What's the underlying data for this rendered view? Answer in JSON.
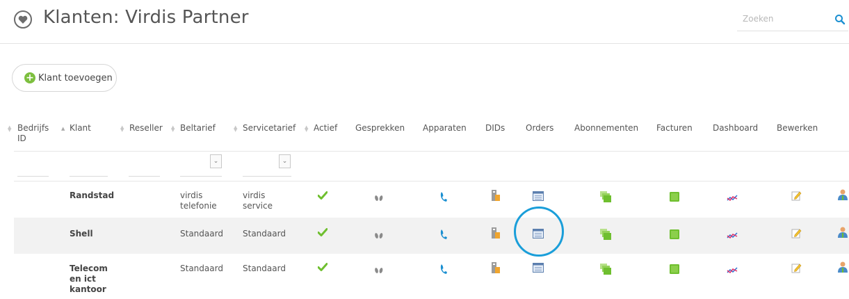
{
  "header": {
    "title": "Klanten: Virdis Partner",
    "search_placeholder": "Zoeken"
  },
  "toolbar": {
    "add_label": "Klant toevoegen"
  },
  "table": {
    "columns": [
      {
        "label": "Bedrijfs ID",
        "line1": "Bedrijfs",
        "line2": "ID"
      },
      {
        "label": "Klant"
      },
      {
        "label": "Reseller"
      },
      {
        "label": "Beltarief"
      },
      {
        "label": "Servicetarief"
      },
      {
        "label": "Actief"
      },
      {
        "label": "Gesprekken"
      },
      {
        "label": "Apparaten"
      },
      {
        "label": "DIDs"
      },
      {
        "label": "Orders"
      },
      {
        "label": "Abonnementen"
      },
      {
        "label": "Facturen"
      },
      {
        "label": "Dashboard"
      },
      {
        "label": "Bewerken"
      }
    ],
    "rows": [
      {
        "klant": "Randstad",
        "beltarief": "virdis telefonie",
        "servicetarief": "virdis service"
      },
      {
        "klant": "Shell",
        "beltarief": "Standaard",
        "servicetarief": "Standaard"
      },
      {
        "klant": "Telecom en ict kantoor",
        "beltarief": "Standaard",
        "servicetarief": "Standaard"
      }
    ]
  },
  "colors": {
    "accent": "#1a9ed9",
    "green": "#7dbf3f",
    "row_alt": "#f2f2f2"
  },
  "icons": [
    "heart-icon",
    "search-icon",
    "plus-icon",
    "checkmark-icon",
    "footprints-icon",
    "phone-icon",
    "device-icon",
    "orders-window-icon",
    "subscriptions-icon",
    "invoice-icon",
    "dashboard-chart-icon",
    "edit-icon",
    "user-icon"
  ]
}
